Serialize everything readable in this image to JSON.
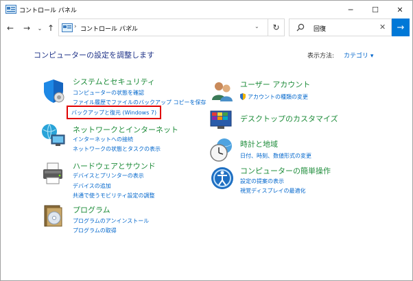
{
  "window": {
    "title": "コントロール パネル",
    "minimize": "─",
    "maximize": "☐",
    "close": "✕"
  },
  "nav": {
    "back": "←",
    "forward": "→",
    "recent": "⌄",
    "up": "↑",
    "address_text": "コントロール パネル",
    "address_chev": "›",
    "address_dropdown": "⌄",
    "refresh": "↻",
    "search_value": "回復",
    "search_clear": "✕",
    "go": "→"
  },
  "main": {
    "heading": "コンピューターの設定を調整します",
    "viewby_label": "表示方法:",
    "viewby_value": "カテゴリ ▾"
  },
  "categories_left": [
    {
      "title": "システムとセキュリティ",
      "links": [
        "コンピューターの状態を確認",
        "ファイル履歴でファイルのバックアップ コピーを保存",
        "バックアップと復元 (Windows 7)"
      ],
      "icon": "shield-icon"
    },
    {
      "title": "ネットワークとインターネット",
      "links": [
        "インターネットへの接続",
        "ネットワークの状態とタスクの表示"
      ],
      "icon": "network-globe-icon"
    },
    {
      "title": "ハードウェアとサウンド",
      "links": [
        "デバイスとプリンターの表示",
        "デバイスの追加",
        "共通で使うモビリティ設定の調整"
      ],
      "icon": "printer-icon"
    },
    {
      "title": "プログラム",
      "links": [
        "プログラムのアンインストール",
        "プログラムの取得"
      ],
      "icon": "programs-disc-icon"
    }
  ],
  "categories_right": [
    {
      "title": "ユーザー アカウント",
      "links": [
        "アカウントの種類の変更"
      ],
      "icon": "user-accounts-icon"
    },
    {
      "title": "デスクトップのカスタマイズ",
      "links": [],
      "icon": "desktop-customize-icon"
    },
    {
      "title": "時計と地域",
      "links": [
        "日付、時刻、数値形式の変更"
      ],
      "icon": "clock-globe-icon"
    },
    {
      "title": "コンピューターの簡単操作",
      "links": [
        "設定の提案の表示",
        "視覚ディスプレイの最適化"
      ],
      "icon": "ease-of-access-icon"
    }
  ],
  "colors": {
    "accent": "#0078d7",
    "category_title": "#1e8c3a",
    "link": "#0066cc",
    "heading": "#1e3287",
    "highlight": "#e00000"
  }
}
